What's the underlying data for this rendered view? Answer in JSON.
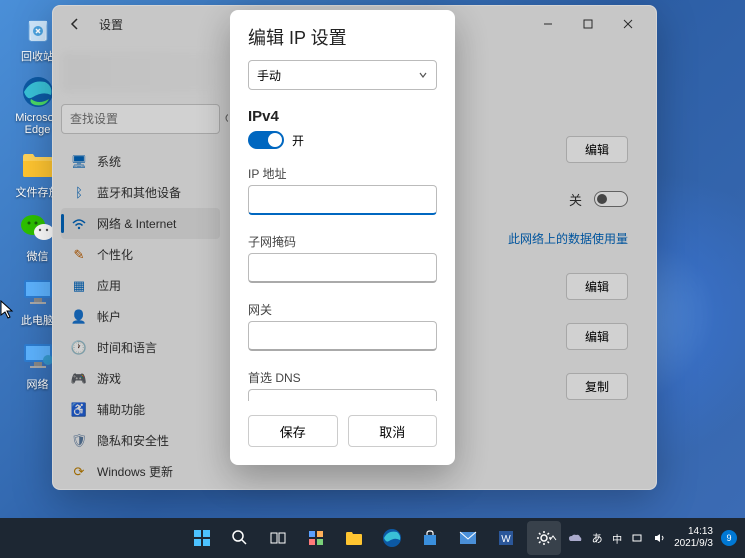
{
  "desktop": {
    "icons": [
      {
        "name": "recycle-bin",
        "label": "回收站"
      },
      {
        "name": "edge",
        "label": "Microsoft Edge"
      },
      {
        "name": "folder",
        "label": "文件存放"
      },
      {
        "name": "wechat",
        "label": "微信"
      },
      {
        "name": "this-pc",
        "label": "此电脑"
      },
      {
        "name": "network",
        "label": "网络"
      }
    ]
  },
  "settings": {
    "title": "设置",
    "search_placeholder": "查找设置",
    "sidebar": [
      {
        "icon": "system",
        "label": "系统"
      },
      {
        "icon": "bluetooth",
        "label": "蓝牙和其他设备"
      },
      {
        "icon": "network",
        "label": "网络 & Internet",
        "active": true
      },
      {
        "icon": "personalize",
        "label": "个性化"
      },
      {
        "icon": "apps",
        "label": "应用"
      },
      {
        "icon": "accounts",
        "label": "帐户"
      },
      {
        "icon": "time",
        "label": "时间和语言"
      },
      {
        "icon": "gaming",
        "label": "游戏"
      },
      {
        "icon": "accessibility",
        "label": "辅助功能"
      },
      {
        "icon": "privacy",
        "label": "隐私和安全性"
      },
      {
        "icon": "update",
        "label": "Windows 更新"
      }
    ],
    "content": {
      "page_title": "以太网",
      "rows": {
        "edit1": "编辑",
        "off_label": "关",
        "data_usage_link": "此网络上的数据使用量",
        "edit2": "编辑",
        "edit3": "编辑",
        "copy": "复制"
      }
    }
  },
  "dialog": {
    "title": "编辑 IP 设置",
    "mode_selected": "手动",
    "ipv4_heading": "IPv4",
    "toggle_label": "开",
    "fields": {
      "ip_label": "IP 地址",
      "ip_value": "",
      "subnet_label": "子网掩码",
      "subnet_value": "",
      "gateway_label": "网关",
      "gateway_value": "",
      "dns_label": "首选 DNS",
      "dns_value": ""
    },
    "save": "保存",
    "cancel": "取消"
  },
  "taskbar": {
    "ime": "中",
    "tray_extra": "あ",
    "time": "14:13",
    "date": "2021/9/3"
  }
}
